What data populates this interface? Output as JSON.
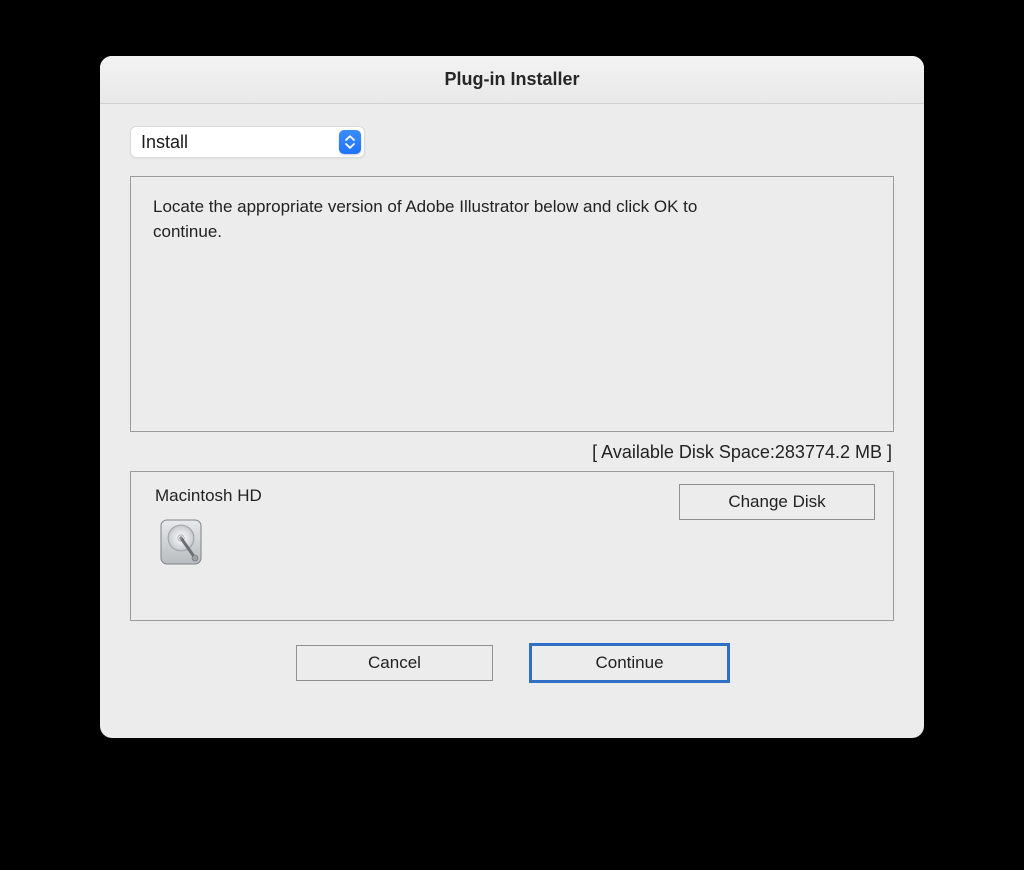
{
  "window": {
    "title": "Plug-in Installer"
  },
  "dropdown": {
    "selected": "Install"
  },
  "instruction": {
    "text": "Locate the appropriate version of Adobe Illustrator below and click OK to continue."
  },
  "disk_space": {
    "label": "[ Available Disk Space:283774.2 MB ]"
  },
  "disk": {
    "name": "Macintosh HD",
    "change_label": "Change Disk"
  },
  "buttons": {
    "cancel": "Cancel",
    "continue": "Continue"
  }
}
